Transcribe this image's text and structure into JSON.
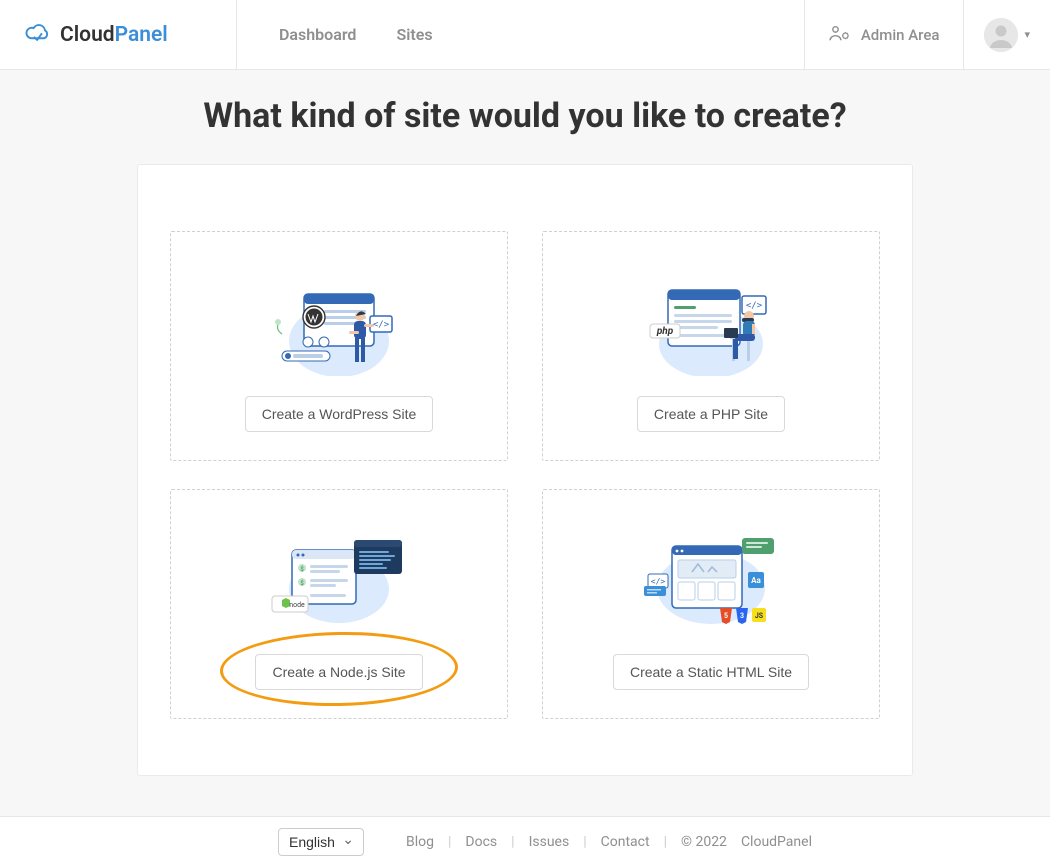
{
  "brand": {
    "cloud": "Cloud",
    "panel": "Panel"
  },
  "nav": {
    "dashboard": "Dashboard",
    "sites": "Sites"
  },
  "admin": {
    "label": "Admin Area"
  },
  "page": {
    "title": "What kind of site would you like to create?"
  },
  "cards": {
    "wordpress": {
      "btn": "Create a WordPress Site"
    },
    "php": {
      "btn": "Create a PHP Site"
    },
    "nodejs": {
      "btn": "Create a Node.js Site",
      "tag": "node"
    },
    "static": {
      "btn": "Create a Static HTML Site"
    }
  },
  "illus": {
    "php_badge": "php"
  },
  "footer": {
    "lang": "English",
    "links": {
      "blog": "Blog",
      "docs": "Docs",
      "issues": "Issues",
      "contact": "Contact"
    },
    "copyright": "© 2022",
    "product": "CloudPanel"
  }
}
